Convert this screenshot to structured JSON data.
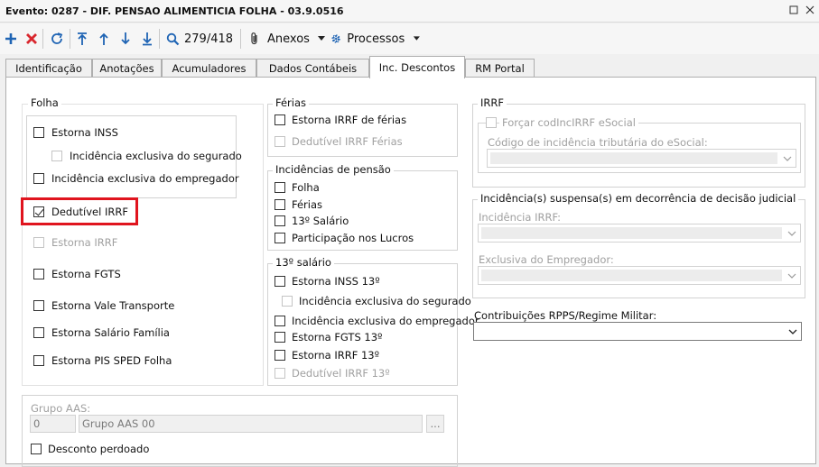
{
  "window": {
    "title": "Evento: 0287 - DIF. PENSAO ALIMENTICIA FOLHA - 03.9.0516",
    "restore_icon": "restore-icon",
    "close_icon": "close-icon"
  },
  "toolbar": {
    "record_position": "279/418",
    "anexos_label": "Anexos",
    "processos_label": "Processos",
    "icons": [
      "add-icon",
      "delete-icon",
      "refresh-icon",
      "first-icon",
      "previous-icon",
      "next-icon",
      "last-icon",
      "search-icon",
      "paperclip-icon",
      "gear-icon"
    ],
    "colors": {
      "primary": "#1f64b4",
      "danger": "#d9272e",
      "highlight": "#e0141e"
    }
  },
  "tabs": [
    {
      "label": "Identificação"
    },
    {
      "label": "Anotações"
    },
    {
      "label": "Acumuladores"
    },
    {
      "label": "Dados Contábeis"
    },
    {
      "label": "Inc. Descontos",
      "active": true
    },
    {
      "label": "RM Portal"
    }
  ],
  "folha": {
    "title": "Folha",
    "estorna_inss": {
      "label": "Estorna INSS",
      "checked": false
    },
    "inc_excl_segurado": {
      "label": "Incidência exclusiva do segurado",
      "checked": false,
      "disabled": true
    },
    "inc_excl_empregador": {
      "label": "Incidência exclusiva do empregador",
      "checked": false
    },
    "dedutivel_irrf": {
      "label": "Dedutível IRRF",
      "checked": true
    },
    "estorna_irrf": {
      "label": "Estorna IRRF",
      "checked": false,
      "disabled": true
    },
    "estorna_fgts": {
      "label": "Estorna FGTS",
      "checked": false
    },
    "estorna_vale_transporte": {
      "label": "Estorna Vale Transporte",
      "checked": false
    },
    "estorna_salario_familia": {
      "label": "Estorna Salário Família",
      "checked": false
    },
    "estorna_pis_sped": {
      "label": "Estorna PIS SPED Folha",
      "checked": false
    }
  },
  "ferias": {
    "title": "Férias",
    "estorna_irrf_ferias": {
      "label": "Estorna IRRF de férias",
      "checked": false
    },
    "dedutivel_irrf_ferias": {
      "label": "Dedutível IRRF Férias",
      "checked": false,
      "disabled": true
    }
  },
  "pensao": {
    "title": "Incidências de pensão",
    "folha": {
      "label": "Folha",
      "checked": false
    },
    "ferias": {
      "label": "Férias",
      "checked": false
    },
    "decimo": {
      "label": "13º Salário",
      "checked": false
    },
    "plr": {
      "label": "Participação nos Lucros",
      "checked": false
    }
  },
  "decimo": {
    "title": "13º salário",
    "estorna_inss_13": {
      "label": "Estorna INSS 13º",
      "checked": false
    },
    "inc_excl_segurado": {
      "label": "Incidência exclusiva do segurado",
      "checked": false,
      "disabled": true
    },
    "inc_excl_empregador": {
      "label": "Incidência exclusiva do empregador",
      "checked": false
    },
    "estorna_fgts_13": {
      "label": "Estorna FGTS 13º",
      "checked": false
    },
    "estorna_irrf_13": {
      "label": "Estorna IRRF 13º",
      "checked": false
    },
    "dedutivel_irrf_13": {
      "label": "Dedutível IRRF 13º",
      "checked": false,
      "disabled": true
    }
  },
  "irrf": {
    "title": "IRRF",
    "forcar": {
      "label": "Forçar codIncIRRF eSocial",
      "checked": false,
      "disabled": true
    },
    "codigo_label": "Código de incidência tributária do eSocial:",
    "codigo_value": ""
  },
  "suspensa": {
    "title": "Incidência(s) suspensa(s) em decorrência de decisão judicial",
    "irrf_label": "Incidência IRRF:",
    "empregador_label": "Exclusiva do Empregador:"
  },
  "rpps": {
    "label": "Contribuições RPPS/Regime Militar:",
    "value": ""
  },
  "aas": {
    "label": "Grupo AAS:",
    "code": "0",
    "name": "Grupo AAS 00",
    "lookup": "...",
    "desconto_perdoado": {
      "label": "Desconto perdoado",
      "checked": false
    }
  }
}
